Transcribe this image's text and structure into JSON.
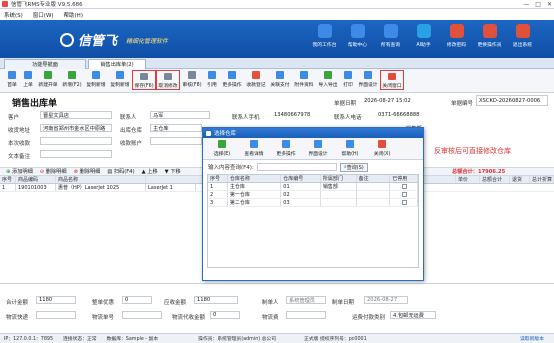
{
  "app": {
    "title": "信管飞RMS专业版 V9.5.686"
  },
  "window_controls": {
    "min": "—",
    "max": "□",
    "close": "✕"
  },
  "menu": [
    "系统(S)",
    "窗口(W)",
    "帮助(H)"
  ],
  "brand": {
    "logo": "信管飞",
    "slogan": "精细化管理软件"
  },
  "topnav": [
    {
      "label": "我的工作台",
      "icon": "home-icon",
      "color": "#3d8be6"
    },
    {
      "label": "帮助中心",
      "icon": "help-icon",
      "color": "#3d8be6"
    },
    {
      "label": "所有查询",
      "icon": "search-icon",
      "color": "#3d8be6"
    },
    {
      "label": "AI助手",
      "icon": "ai-icon",
      "color": "#2aa0e6"
    },
    {
      "label": "修改密码",
      "icon": "key-icon",
      "color": "#e0513c"
    },
    {
      "label": "更换操作员",
      "icon": "user-icon",
      "color": "#e0513c"
    },
    {
      "label": "退出系统",
      "icon": "exit-icon",
      "color": "#e0513c"
    }
  ],
  "tabs": [
    "功能导航面",
    "销售出库单(2)"
  ],
  "toolbar": [
    {
      "label": "首单",
      "icon": "first-icon"
    },
    {
      "label": "上单",
      "icon": "prev-icon"
    },
    {
      "label": "新建开单",
      "icon": "new-icon"
    },
    {
      "label": "新增(F2)",
      "icon": "add-icon"
    },
    {
      "label": "复制新增",
      "icon": "copy-icon"
    },
    {
      "label": "复制新增",
      "icon": "copy2-icon"
    },
    {
      "label": "保存(F6)",
      "icon": "save-icon",
      "boxed": true
    },
    {
      "label": "取消修改",
      "icon": "undo-icon",
      "boxed": true
    },
    {
      "label": "审核(F8)",
      "icon": "audit-icon"
    },
    {
      "label": "引用",
      "icon": "cite-icon"
    },
    {
      "label": "更多操作",
      "icon": "more-icon"
    },
    {
      "label": "收款登记",
      "icon": "pay-icon"
    },
    {
      "label": "关联支付",
      "icon": "link-icon"
    },
    {
      "label": "附件资料",
      "icon": "attach-icon"
    },
    {
      "label": "导入导出",
      "icon": "io-icon"
    },
    {
      "label": "打印",
      "icon": "print-icon"
    },
    {
      "label": "界面设计",
      "icon": "design-icon"
    },
    {
      "label": "关闭窗口",
      "icon": "close-icon",
      "boxed": true
    }
  ],
  "form": {
    "title": "销售出库单",
    "date_label": "单据日期",
    "date_value": "2026-08-27 15:02",
    "no_label": "单据编号",
    "no_value": "XSCKD-20260827-0006",
    "customer_label": "客户",
    "customer_value": "晋星文具店",
    "contact_label": "联系人",
    "contact_value": "马军",
    "phone_label": "联系人手机",
    "phone_value": "13480667978",
    "tel_label": "联系人电话",
    "tel_value": "0371-66668888",
    "address_label": "收货地址",
    "address_value": "河南省郑州市金水区中原路",
    "warehouse_label": "出库仓库",
    "warehouse_value": "主仓库",
    "invoice_label": "发票",
    "invoice_value": "0",
    "dept_label": "部门",
    "dept_value": "销售部",
    "receive_label": "本次收款",
    "account_label": "收款账户",
    "remark_label": "文本备注"
  },
  "section": {
    "add": "添加明细",
    "delete": "删除明细",
    "batch": "删除明细",
    "scan": "扫码(F4)",
    "up": "上移",
    "down": "下移",
    "amount_label": "总额合计：",
    "amount_value": "17906.25"
  },
  "grid": {
    "headers": [
      "序号",
      "商品编码",
      "商品名称",
      "",
      "",
      "",
      "",
      "",
      "",
      "",
      "",
      "",
      "",
      "",
      "",
      "单价",
      "总额合计",
      "",
      "退货",
      "总计折算"
    ],
    "rows": [
      [
        "1",
        "190101003",
        "惠普（HP）LaserJet 1025",
        "",
        "LaserJet 1",
        "",
        "",
        "",
        "",
        "",
        "",
        "",
        "",
        "",
        "",
        "",
        "",
        "",
        "",
        ""
      ]
    ]
  },
  "summary": {
    "qty_label": "合计金额",
    "qty_value": "1180",
    "disc_label": "整单优惠",
    "disc_value": "0",
    "total_label": "应收金额",
    "total_value": "1180",
    "maker_label": "制单人",
    "maker_value": "系统管理员",
    "made_date_label": "制单日期",
    "made_date_value": "2026-08-27",
    "ship_label": "物流快递",
    "ship_no_label": "物流单号",
    "ship_fee_label": "物流代收金额",
    "ship_fee_value": "0",
    "ship_type_label": "运费付款类别",
    "ship_type_value": "4.包邮无运费",
    "payer_label": "物流费"
  },
  "status": {
    "ip": "IP：127.0.0.1：7895",
    "conn": "连接状态：正常",
    "db": "数据库：Sample - 副本",
    "op": "操作员：系统管理员(admin) 总公司",
    "license": "正式版 授权序列号：pc0001",
    "update": "读取新版本"
  },
  "dialog": {
    "title": "选择仓库",
    "toolbar": [
      {
        "label": "选择(E)",
        "icon": "check-icon",
        "color": "#3aa53a"
      },
      {
        "label": "查看详情",
        "icon": "detail-icon",
        "color": "#3d8be6"
      },
      {
        "label": "更多操作",
        "icon": "more-icon",
        "color": "#3d8be6"
      },
      {
        "label": "界面设计",
        "icon": "design-icon",
        "color": "#3d8be6"
      },
      {
        "label": "帮助(H)",
        "icon": "help-icon",
        "color": "#3d8be6"
      },
      {
        "label": "关闭(X)",
        "icon": "close-icon",
        "color": "#e0513c"
      }
    ],
    "search_label": "输入内容查询(F4):",
    "search_btn": "查询(S)",
    "headers": [
      "序号",
      "仓库名称",
      "仓库编号",
      "所属部门",
      "备注",
      "已停用"
    ],
    "rows": [
      [
        "1",
        "主仓库",
        "01",
        "销售部",
        "",
        ""
      ],
      [
        "2",
        "第一仓库",
        "02",
        "",
        "",
        ""
      ],
      [
        "3",
        "第二仓库",
        "03",
        "",
        "",
        ""
      ]
    ]
  },
  "annotation": "反审核后可直接修改仓库"
}
